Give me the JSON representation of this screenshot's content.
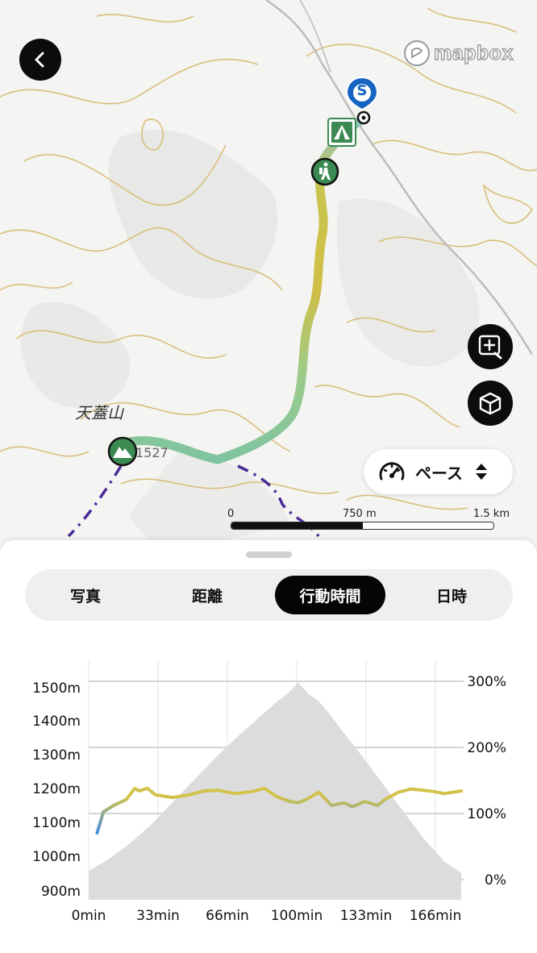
{
  "map": {
    "attribution": "mapbox",
    "peak_name": "天蓋山",
    "peak_elevation": "1527",
    "start_marker": "S",
    "scale": {
      "labels": [
        "0",
        "750 m",
        "1.5 km"
      ]
    },
    "pace_selector": {
      "label": "ペース"
    },
    "icons": {
      "back": "chevron-left-icon",
      "zoom": "zoom-in-icon",
      "view3d": "cube-icon",
      "pace": "speedometer-icon",
      "sort": "up-down-arrows-icon"
    }
  },
  "tabs": [
    {
      "label": "写真",
      "active": false
    },
    {
      "label": "距離",
      "active": false
    },
    {
      "label": "行動時間",
      "active": true
    },
    {
      "label": "日時",
      "active": false
    }
  ],
  "colors": {
    "active_tab": "#050505",
    "route_start": "#5aa8d8",
    "route_mid": "#7fc4a0",
    "route_high": "#d2c24a",
    "profile_fill": "#dcdcdc"
  },
  "chart_data": {
    "type": "area",
    "x_ticks": [
      "0min",
      "33min",
      "66min",
      "100min",
      "133min",
      "166min"
    ],
    "y_left_ticks": [
      "1500m",
      "1400m",
      "1300m",
      "1200m",
      "1100m",
      "1000m",
      "900m"
    ],
    "y_right_ticks": [
      "300%",
      "200%",
      "100%",
      "0%"
    ],
    "xlim": [
      0,
      178
    ],
    "ylim_left": [
      900,
      1527
    ],
    "ylim_right": [
      0,
      300
    ],
    "series": [
      {
        "axis": "left",
        "x": [
          0,
          10,
          20,
          30,
          40,
          50,
          60,
          70,
          80,
          90,
          95,
          100,
          105,
          110,
          115,
          120,
          130,
          140,
          150,
          160,
          170,
          178
        ],
        "y": [
          925,
          965,
          1015,
          1075,
          1145,
          1215,
          1285,
          1350,
          1410,
          1470,
          1495,
          1530,
          1495,
          1470,
          1430,
          1385,
          1300,
          1210,
          1120,
          1030,
          955,
          920
        ]
      },
      {
        "axis": "right",
        "x": [
          4,
          7,
          12,
          18,
          22,
          24,
          28,
          32,
          40,
          48,
          55,
          62,
          70,
          78,
          84,
          90,
          96,
          100,
          104,
          110,
          116,
          122,
          126,
          132,
          138,
          142,
          148,
          154,
          160,
          165,
          170,
          178
        ],
        "y": [
          70,
          102,
          112,
          121,
          138,
          134,
          138,
          128,
          124,
          128,
          134,
          135,
          130,
          133,
          138,
          125,
          118,
          116,
          121,
          132,
          112,
          116,
          110,
          118,
          112,
          122,
          132,
          137,
          135,
          133,
          130,
          134
        ]
      }
    ]
  }
}
